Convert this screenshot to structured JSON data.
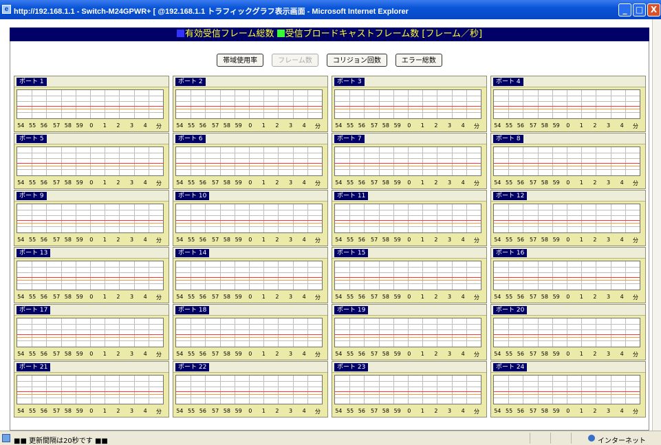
{
  "window": {
    "title": "http://192.168.1.1 - Switch-M24GPWR+ [ @192.168.1.1 トラフィックグラフ表示画面 - Microsoft Internet Explorer",
    "minimize": "_",
    "maximize": "□",
    "close": "X"
  },
  "legend": {
    "item1_label": "有効受信フレーム総数",
    "item1_color": "#3333ff",
    "item2_label": "受信ブロードキャストフレーム数 [フレーム／秒]",
    "item2_color": "#33ff33"
  },
  "buttons": [
    {
      "label": "帯域使用率",
      "enabled": true
    },
    {
      "label": "フレーム数",
      "enabled": false
    },
    {
      "label": "コリジョン回数",
      "enabled": true
    },
    {
      "label": "エラー総数",
      "enabled": true
    }
  ],
  "axis_ticks": [
    "54",
    "55",
    "56",
    "57",
    "58",
    "59",
    "0",
    "1",
    "2",
    "3",
    "4"
  ],
  "axis_unit": "分",
  "ports": [
    "ポート 1",
    "ポート 2",
    "ポート 3",
    "ポート 4",
    "ポート 5",
    "ポート 6",
    "ポート 7",
    "ポート 8",
    "ポート 9",
    "ポート 10",
    "ポート 11",
    "ポート 12",
    "ポート 13",
    "ポート 14",
    "ポート 15",
    "ポート 16",
    "ポート 17",
    "ポート 18",
    "ポート 19",
    "ポート 20",
    "ポート 21",
    "ポート 22",
    "ポート 23",
    "ポート 24"
  ],
  "colors": {
    "panel_bg": "#ebeaa8",
    "label_bg": "#000066",
    "legend_bg": "#000066",
    "legend_text": "#ffff33",
    "grid_line": "#bdbdbd",
    "baseline_red": "#ff3333",
    "baseline_orange": "#ff9933"
  },
  "status": {
    "text": "■■ 更新間隔は20秒です ■■",
    "zone": "インターネット"
  }
}
